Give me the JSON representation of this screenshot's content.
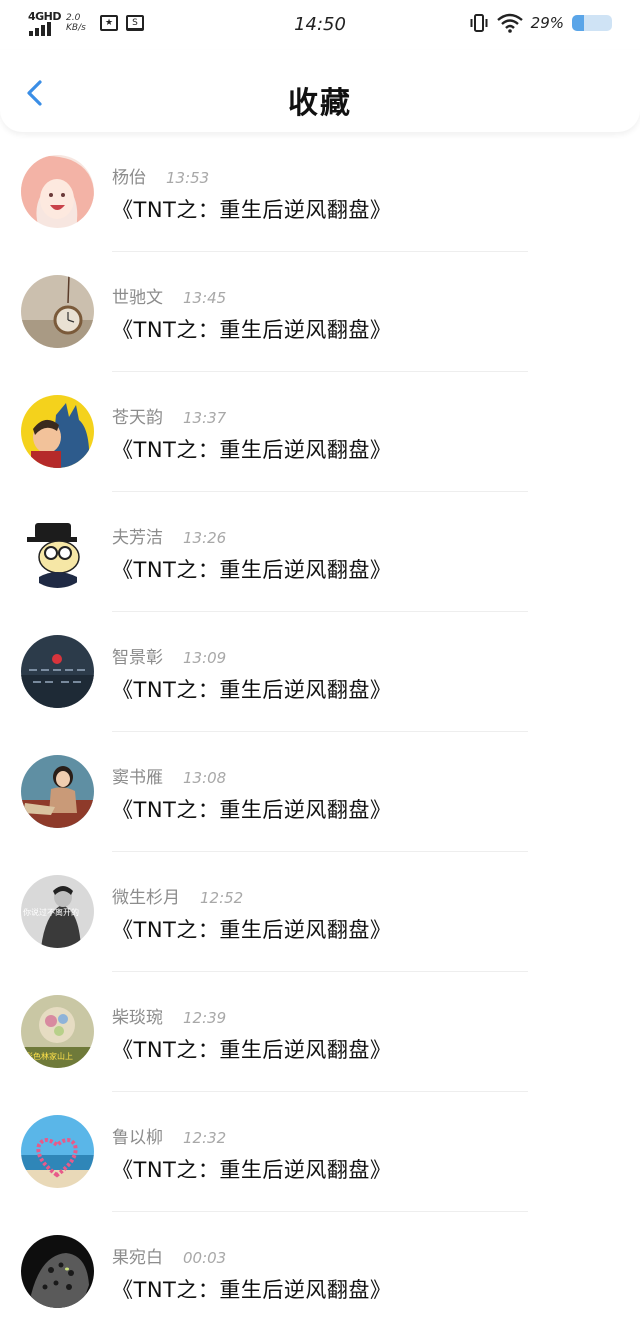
{
  "status_bar": {
    "network": "4GHD",
    "speed_value": "2.0",
    "speed_unit": "KB/s",
    "time": "14:50",
    "battery_text": "29%",
    "battery_level": 0.29,
    "icons": [
      "signal-icon",
      "star-frame-icon",
      "news-icon",
      "vibrate-icon",
      "wifi-icon",
      "battery-icon"
    ]
  },
  "header": {
    "title": "收藏",
    "back_icon": "chevron-left-icon",
    "accent": "#3a8ee6"
  },
  "items": [
    {
      "name": "杨佁",
      "time": "13:53",
      "book": "《TNT之：重生后逆风翻盘》"
    },
    {
      "name": "世驰文",
      "time": "13:45",
      "book": "《TNT之：重生后逆风翻盘》"
    },
    {
      "name": "苍天韵",
      "time": "13:37",
      "book": "《TNT之：重生后逆风翻盘》"
    },
    {
      "name": "夫芳洁",
      "time": "13:26",
      "book": "《TNT之：重生后逆风翻盘》"
    },
    {
      "name": "智景彰",
      "time": "13:09",
      "book": "《TNT之：重生后逆风翻盘》"
    },
    {
      "name": "窦书雁",
      "time": "13:08",
      "book": "《TNT之：重生后逆风翻盘》"
    },
    {
      "name": "微生杉月",
      "time": "12:52",
      "book": "《TNT之：重生后逆风翻盘》"
    },
    {
      "name": "柴琰琬",
      "time": "12:39",
      "book": "《TNT之：重生后逆风翻盘》"
    },
    {
      "name": "鲁以柳",
      "time": "12:32",
      "book": "《TNT之：重生后逆风翻盘》"
    },
    {
      "name": "果宛白",
      "time": "00:03",
      "book": "《TNT之：重生后逆风翻盘》"
    }
  ],
  "avatar_overlay_text": {
    "a7": "你说过不离开的",
    "a8": "彩色林家山上"
  }
}
